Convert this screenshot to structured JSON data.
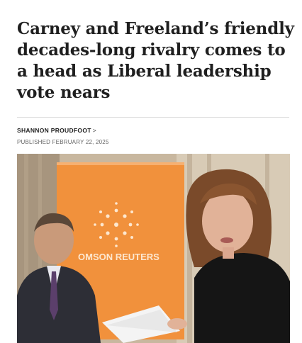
{
  "article": {
    "headline": "Carney and Freeland’s friendly decades-long rivalry comes to a head as Liberal leadership vote nears",
    "byline": "SHANNON PROUDFOOT",
    "byline_chevron": ">",
    "published": "PUBLISHED FEBRUARY 22, 2025"
  },
  "photo": {
    "backdrop_text": "OMSON REUTERS"
  }
}
